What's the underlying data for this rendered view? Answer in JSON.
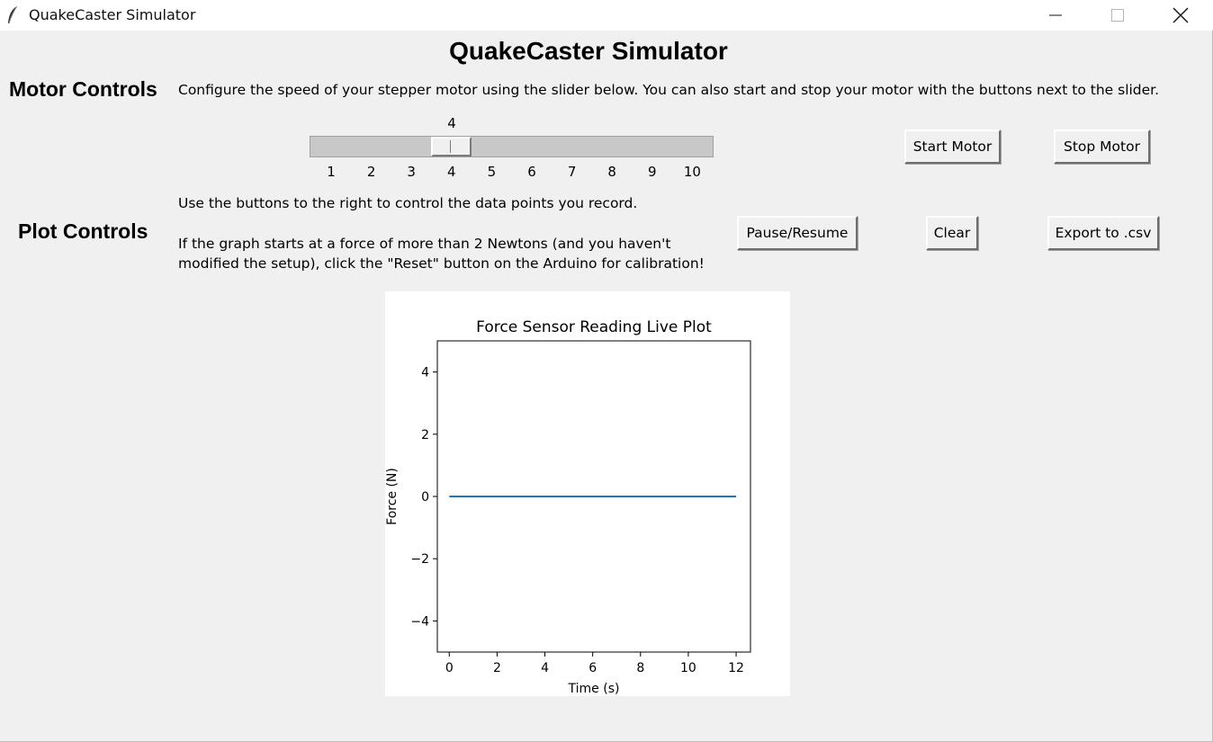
{
  "window": {
    "title": "QuakeCaster Simulator",
    "controls": {
      "minimize": "minimize-icon",
      "maximize": "maximize-icon",
      "close": "close-icon"
    }
  },
  "app": {
    "title": "QuakeCaster Simulator"
  },
  "motor": {
    "label": "Motor Controls",
    "description": "Configure the speed of your stepper motor using the slider below. You can also start and stop your motor with the buttons next to the slider.",
    "slider": {
      "value": 4,
      "min": 1,
      "max": 10,
      "ticks": [
        "1",
        "2",
        "3",
        "4",
        "5",
        "6",
        "7",
        "8",
        "9",
        "10"
      ]
    },
    "start_label": "Start Motor",
    "stop_label": "Stop Motor"
  },
  "plot_controls": {
    "label": "Plot Controls",
    "description1": "Use the buttons to the right to control the data points you record.",
    "description2_line1": "If the graph starts at a force of more than 2 Newtons (and you haven't",
    "description2_line2": "modified the setup), click the \"Reset\" button on the Arduino for calibration!",
    "pause_label": "Pause/Resume",
    "clear_label": "Clear",
    "export_label": "Export to .csv"
  },
  "chart_data": {
    "type": "line",
    "title": "Force Sensor Reading Live Plot",
    "xlabel": "Time (s)",
    "ylabel": "Force (N)",
    "xlim": [
      -0.5,
      12.6
    ],
    "ylim": [
      -5,
      5
    ],
    "xticks": [
      0,
      2,
      4,
      6,
      8,
      10,
      12
    ],
    "yticks": [
      4,
      2,
      0,
      -2,
      -4
    ],
    "ytick_labels": [
      "4",
      "2",
      "0",
      "−2",
      "−4"
    ],
    "series": [
      {
        "x": [
          0,
          12
        ],
        "y": [
          0,
          0
        ],
        "color": "#1f77b4"
      }
    ],
    "grid": false
  }
}
